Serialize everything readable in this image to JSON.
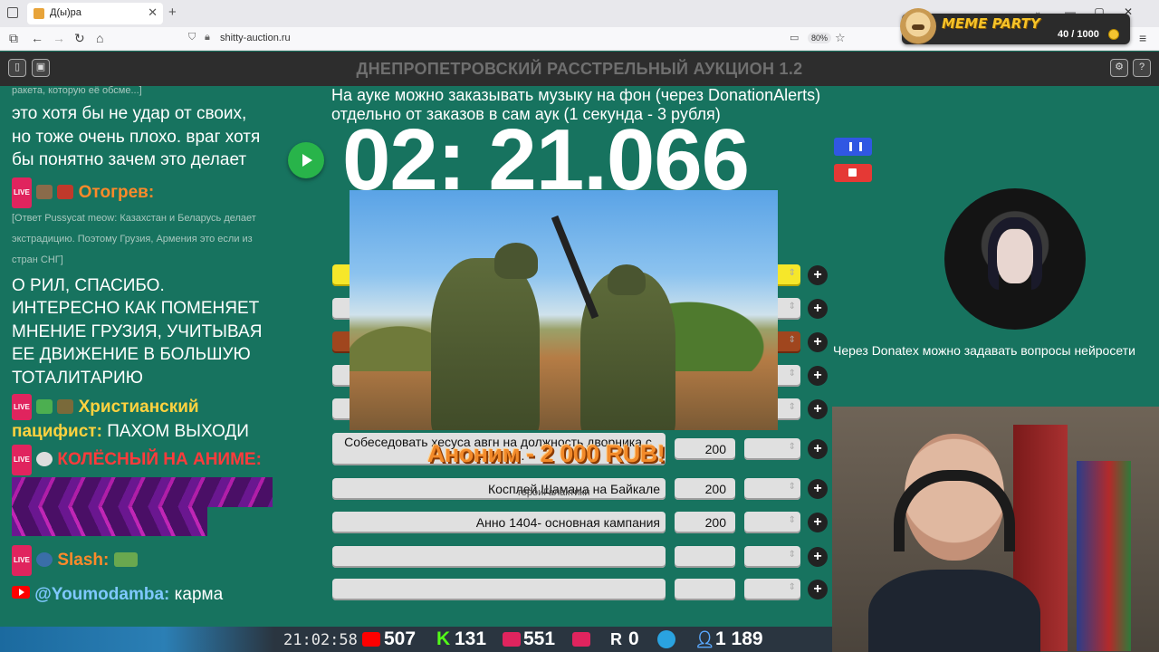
{
  "browser": {
    "tab_title": "Д(ы)ра",
    "tab_close": "✕",
    "new_tab": "+",
    "url": "shitty-auction.ru",
    "zoom": "80%",
    "win_min": "—",
    "win_max": "▢",
    "win_close": "✕"
  },
  "meme_party": {
    "name": "MEME PARTY",
    "count": "40 / 1000"
  },
  "app": {
    "title": "ДНЕПРОПЕТРОВСКИЙ РАССТРЕЛЬНЫЙ АУКЦИОН 1.2"
  },
  "chat": {
    "top_quote": "ракета, которую её обсме...]",
    "msg1": "это хотя бы не удар от своих, но тоже очень плохо. враг хотя бы понятно зачем это делает",
    "user2": "Отогрев:",
    "quote2": "[Ответ Pussycat meow: Казахстан и Беларусь делает экстрадицию. Поэтому Грузия, Армения это если из стран СНГ]",
    "msg2": "О РИЛ, СПАСИБО. ИНТЕРЕСНО КАК ПОМЕНЯЕТ МНЕНИЕ ГРУЗИЯ, УЧИТЫВАЯ ЕЕ ДВИЖЕНИЕ В БОЛЬШУЮ ТОТАЛИТАРИЮ",
    "user3": "Христианский пацифист:",
    "msg3": "ПАХОМ ВЫХОДИ",
    "user4": "КОЛЁСНЫЙ НА АНИМЕ:",
    "user5": "Slash:",
    "user6": "@Youmodamba:",
    "msg6": "карма",
    "live_badge": "LIVE"
  },
  "auction": {
    "info": "На ауке можно заказывать музыку на фон (через DonationAlerts) отдельно от заказов в сам аук (1 секунда - 3 рубля)",
    "timer": "02: 21.066",
    "lots": [
      {
        "name": "",
        "amount": ""
      },
      {
        "name": "",
        "amount": ""
      },
      {
        "name": "",
        "amount": ""
      },
      {
        "name": "",
        "amount": ""
      },
      {
        "name": "",
        "amount": ""
      },
      {
        "name": "Собеседовать хесуса авгн на должность дворника с ...том е...",
        "amount": "200"
      },
      {
        "name": "Косплей Шамана на Байкале",
        "amount": "200"
      },
      {
        "name": "Анно 1404- основная кампания",
        "amount": "200"
      },
      {
        "name": "",
        "amount": ""
      },
      {
        "name": "",
        "amount": ""
      }
    ],
    "plus": "+"
  },
  "donation": {
    "name": "Аноним - 2 000 RUB!",
    "message": "героиГалактики"
  },
  "right": {
    "donatex_note": "Через Donatex можно задавать вопросы нейросети"
  },
  "stats": {
    "clock": "21:02:58",
    "youtube": "507",
    "kick": "131",
    "vk_live": "551",
    "rutube": "0",
    "telegram": "",
    "total": "1 189",
    "kick_letter": "K",
    "rutube_letter": "R"
  },
  "colors": {
    "page_bg": "#17735f",
    "accent_yellow": "#f6e72a",
    "accent_brown": "#a0461e",
    "pause": "#3057e3",
    "stop": "#e53935",
    "play": "#28b44a"
  }
}
